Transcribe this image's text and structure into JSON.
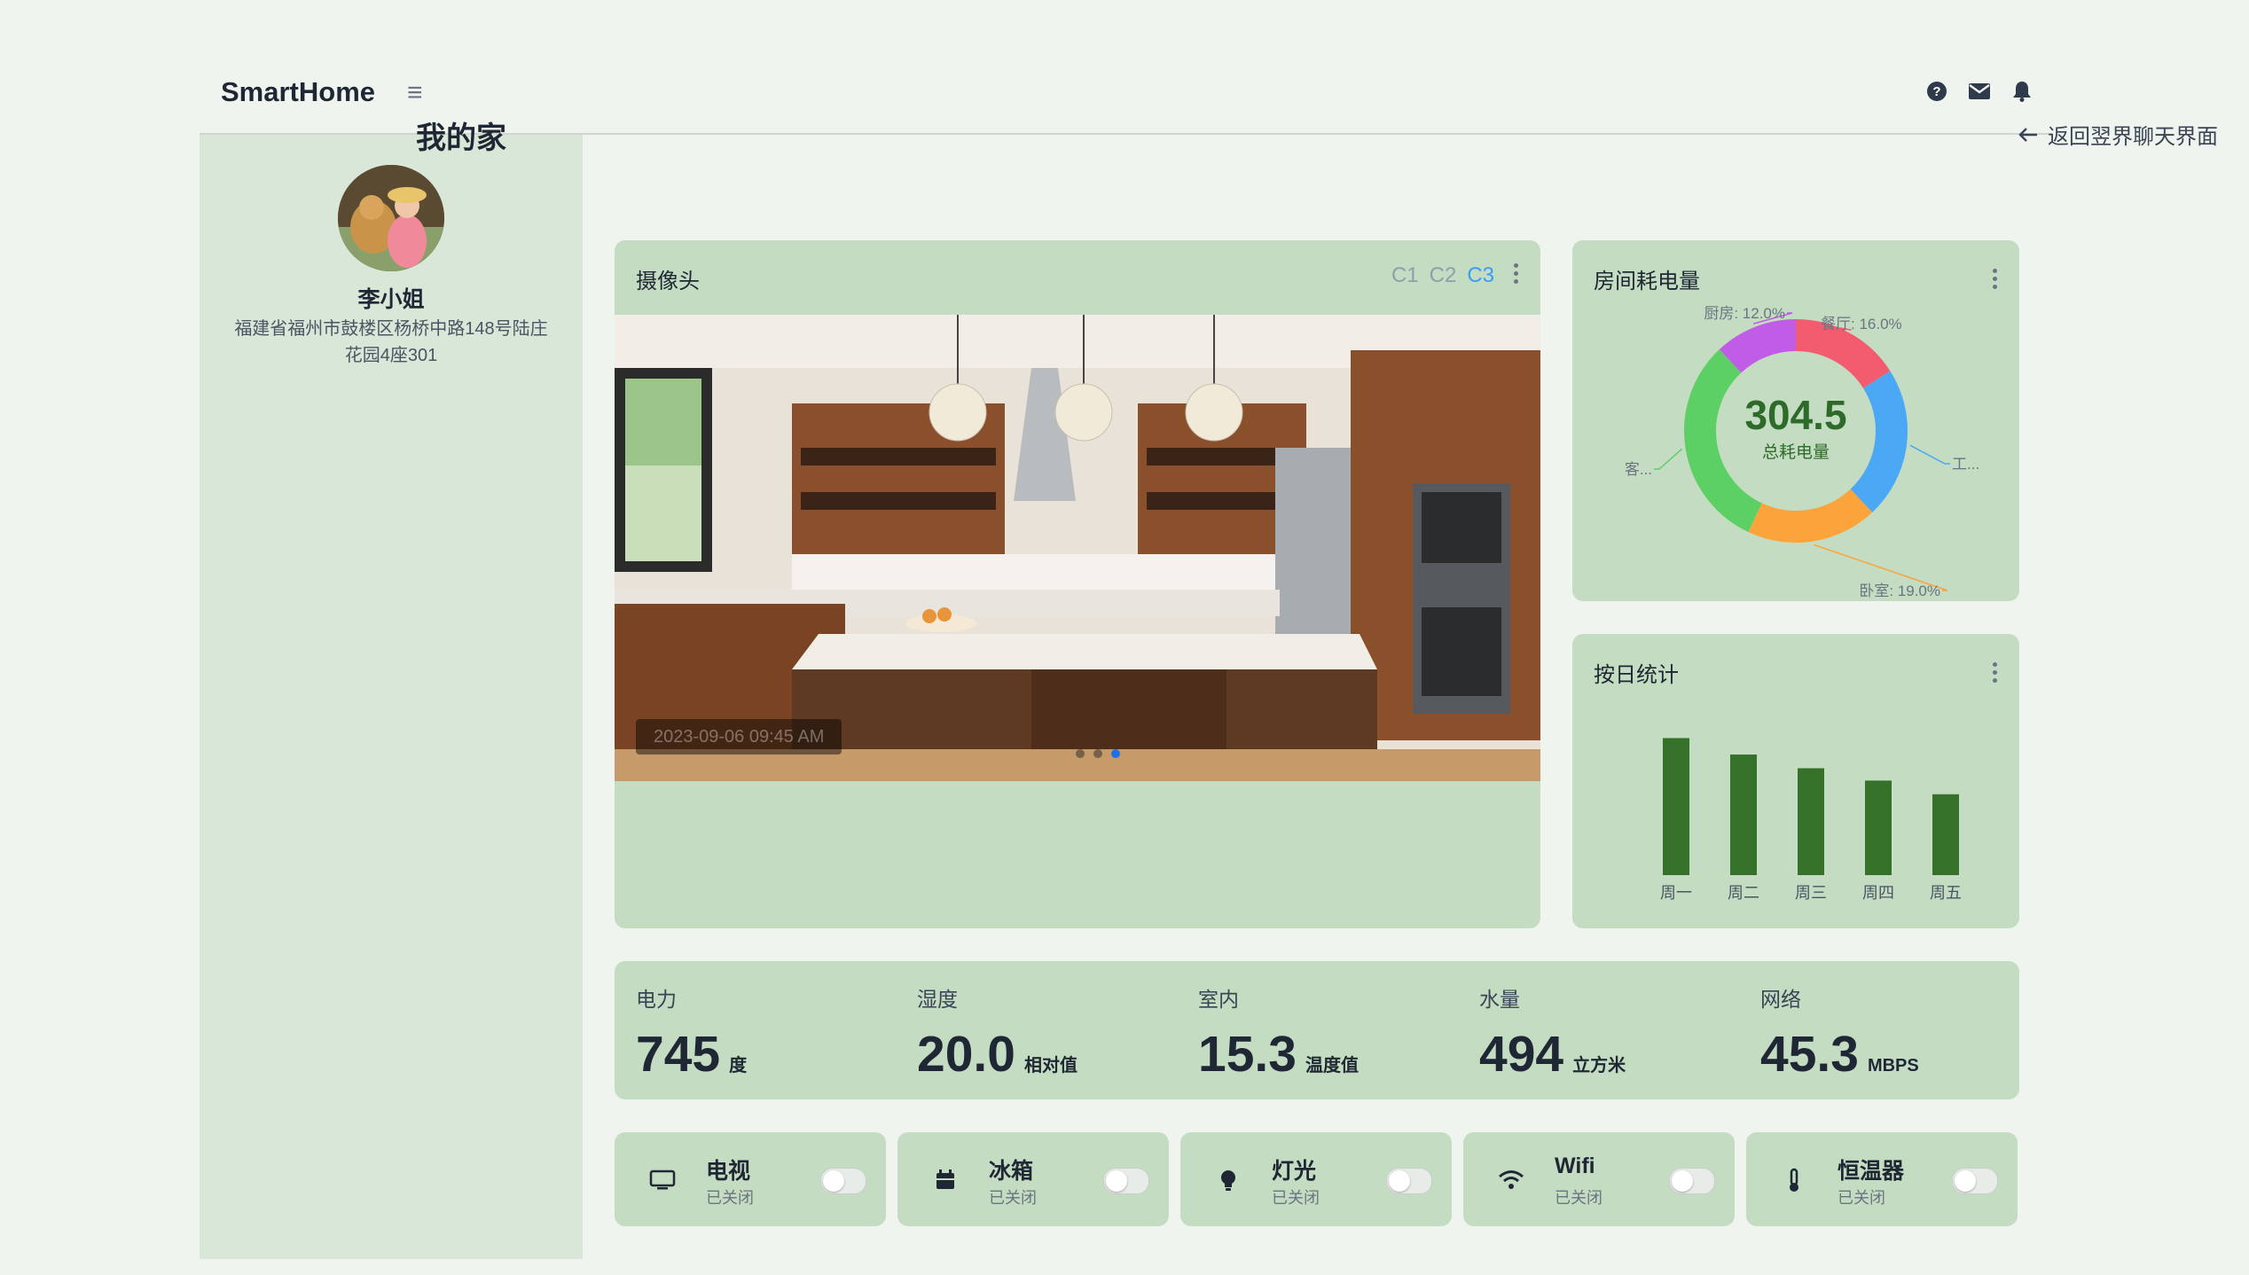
{
  "header": {
    "brand": "SmartHome",
    "menu_icon": "hamburger-icon",
    "icons": [
      "help-icon",
      "mail-icon",
      "bell-icon"
    ]
  },
  "user": {
    "name": "李小姐",
    "address": "福建省福州市鼓楼区杨桥中路148号陆庄花园4座301"
  },
  "page": {
    "title": "我的家",
    "back_label": "返回翌界聊天界面"
  },
  "camera": {
    "title": "摄像头",
    "tabs": [
      {
        "label": "C1",
        "active": false
      },
      {
        "label": "C2",
        "active": false
      },
      {
        "label": "C3",
        "active": true
      }
    ],
    "timestamp": "2023-09-06 09:45 AM",
    "slide_count": 3,
    "active_slide": 2
  },
  "energy": {
    "title": "房间耗电量",
    "total": "304.5",
    "total_label": "总耗电量",
    "labels": [
      "厨房: 12.0%",
      "餐厅: 16.0%",
      "工...",
      "卧室: 19.0%",
      "客..."
    ]
  },
  "daily": {
    "title": "按日统计"
  },
  "chart_data": [
    {
      "type": "pie",
      "title": "房间耗电量",
      "center_value": 304.5,
      "center_label": "总耗电量",
      "slices": [
        {
          "label": "餐厅",
          "percent": 16.0,
          "color": "#f25c6e"
        },
        {
          "label": "工...",
          "percent": 22.0,
          "color": "#4aa8f5"
        },
        {
          "label": "卧室",
          "percent": 19.0,
          "color": "#fca43c"
        },
        {
          "label": "客...",
          "percent": 31.0,
          "color": "#5dd065"
        },
        {
          "label": "厨房",
          "percent": 12.0,
          "color": "#c05ce6"
        }
      ]
    },
    {
      "type": "bar",
      "title": "按日统计",
      "categories": [
        "周一",
        "周二",
        "周三",
        "周四",
        "周五"
      ],
      "values": [
        100,
        88,
        78,
        69,
        59
      ],
      "ylim": [
        0,
        110
      ],
      "color": "#367129"
    }
  ],
  "stats": [
    {
      "label": "电力",
      "value": "745",
      "unit": "度"
    },
    {
      "label": "湿度",
      "value": "20.0",
      "unit": "相对值"
    },
    {
      "label": "室内",
      "value": "15.3",
      "unit": "温度值"
    },
    {
      "label": "水量",
      "value": "494",
      "unit": "立方米"
    },
    {
      "label": "网络",
      "value": "45.3",
      "unit": "MBPS"
    }
  ],
  "devices": [
    {
      "name": "电视",
      "state": "已关闭",
      "icon": "tv-icon",
      "on": false
    },
    {
      "name": "冰箱",
      "state": "已关闭",
      "icon": "fridge-icon",
      "on": false
    },
    {
      "name": "灯光",
      "state": "已关闭",
      "icon": "bulb-icon",
      "on": false
    },
    {
      "name": "Wifi",
      "state": "已关闭",
      "icon": "wifi-icon",
      "on": false
    },
    {
      "name": "恒温器",
      "state": "已关闭",
      "icon": "thermometer-icon",
      "on": false
    }
  ]
}
